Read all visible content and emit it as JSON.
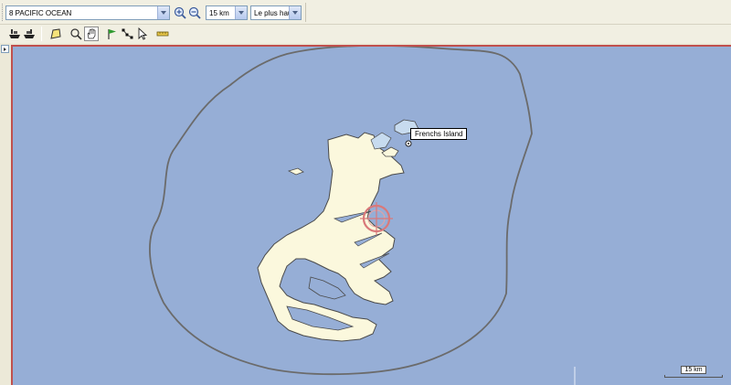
{
  "toolbar": {
    "region_value": "8 PACIFIC OCEAN",
    "scale_value": "15 km",
    "detail_value": "Le plus haut",
    "icons": [
      "ship-icon",
      "ship-icon",
      "shape-icon",
      "zoom-area-icon",
      "hand-icon",
      "flag-icon",
      "route-icon",
      "pointer-icon",
      "ruler-icon"
    ]
  },
  "map": {
    "place_label": "Frenchs Island",
    "scale_label": "15 km",
    "colors": {
      "sea": "#96aed6",
      "land": "#fbf8dd",
      "coast": "#5a5a5a",
      "boundary": "#6b6b6b",
      "shoal": "#c7dbef",
      "crosshair": "#d9797a"
    }
  }
}
